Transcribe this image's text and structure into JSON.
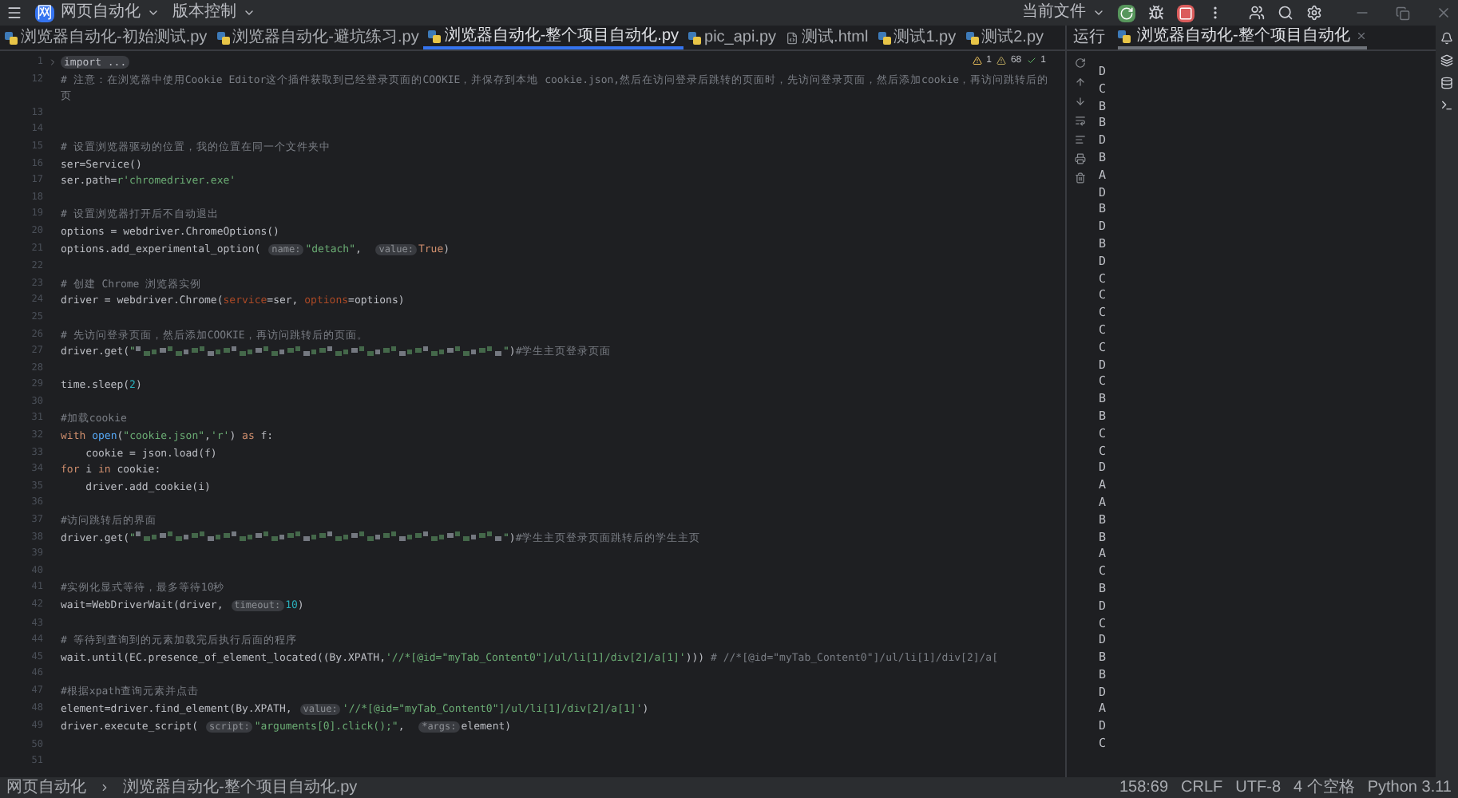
{
  "title_bar": {
    "project_badge": "网",
    "project": "网页自动化",
    "vcs": "版本控制",
    "run_config": "当前文件"
  },
  "editor_tabs": [
    {
      "label": "浏览器自动化-初始测试.py",
      "selected": false,
      "kind": "python"
    },
    {
      "label": "浏览器自动化-避坑练习.py",
      "selected": false,
      "kind": "python"
    },
    {
      "label": "浏览器自动化-整个项目自动化.py",
      "selected": true,
      "kind": "python"
    },
    {
      "label": "pic_api.py",
      "selected": false,
      "kind": "python"
    },
    {
      "label": "测试.html",
      "selected": false,
      "kind": "html"
    },
    {
      "label": "测试1.py",
      "selected": false,
      "kind": "python"
    },
    {
      "label": "测试2.py",
      "selected": false,
      "kind": "python"
    }
  ],
  "inspections": {
    "warnings": "1",
    "weak_warnings": "68",
    "ok": "1"
  },
  "code_lines": [
    {
      "number": "1",
      "segments": [
        {
          "kind": "folded",
          "text": "import ..."
        }
      ]
    },
    {
      "number": "12",
      "segments": [
        {
          "kind": "comment",
          "text": "# 注意：在浏览器中使用Cookie Editor这个插件获取到已经登录页面的COOKIE，并保存到本地 cookie.json,然后在访问登录后跳转的页面时，先访问登录页面，然后添加cookie，再访问跳转后的页"
        }
      ]
    },
    {
      "number": "13"
    },
    {
      "number": "14"
    },
    {
      "number": "15",
      "segments": [
        {
          "kind": "comment",
          "text": "# 设置浏览器驱动的位置，我的位置在同一个文件夹中"
        }
      ]
    },
    {
      "number": "16",
      "segments": [
        {
          "kind": "plain",
          "text": "ser=Service()"
        }
      ]
    },
    {
      "number": "17",
      "segments": [
        {
          "kind": "plain",
          "text": "ser.path="
        },
        {
          "kind": "string",
          "text": "r'chromedriver.exe'"
        }
      ]
    },
    {
      "number": "18"
    },
    {
      "number": "19",
      "segments": [
        {
          "kind": "comment",
          "text": "# 设置浏览器打开后不自动退出"
        }
      ]
    },
    {
      "number": "20",
      "segments": [
        {
          "kind": "plain",
          "text": "options = webdriver.ChromeOptions()"
        }
      ]
    },
    {
      "number": "21",
      "segments": [
        {
          "kind": "plain",
          "text": "options.add_experimental_option( "
        },
        {
          "kind": "hint",
          "text": "name:"
        },
        {
          "kind": "string",
          "text": "\"detach\""
        },
        {
          "kind": "plain",
          "text": ",  "
        },
        {
          "kind": "hint",
          "text": "value:"
        },
        {
          "kind": "keyword",
          "text": "True"
        },
        {
          "kind": "plain",
          "text": ")"
        }
      ]
    },
    {
      "number": "22"
    },
    {
      "number": "23",
      "segments": [
        {
          "kind": "comment",
          "text": "# 创建 Chrome 浏览器实例"
        }
      ]
    },
    {
      "number": "24",
      "segments": [
        {
          "kind": "plain",
          "text": "driver = webdriver.Chrome("
        },
        {
          "kind": "param",
          "text": "service"
        },
        {
          "kind": "plain",
          "text": "=ser, "
        },
        {
          "kind": "param",
          "text": "options"
        },
        {
          "kind": "plain",
          "text": "=options)"
        }
      ]
    },
    {
      "number": "25"
    },
    {
      "number": "26",
      "segments": [
        {
          "kind": "comment",
          "text": "# 先访问登录页面，然后添加COOKIE，再访问跳转后的页面。"
        }
      ]
    },
    {
      "number": "27",
      "segments": [
        {
          "kind": "plain",
          "text": "driver.get("
        },
        {
          "kind": "string",
          "text": "\""
        },
        {
          "kind": "redacted"
        },
        {
          "kind": "string",
          "text": "\""
        },
        {
          "kind": "plain",
          "text": ")"
        },
        {
          "kind": "comment",
          "text": "#学生主页登录页面"
        }
      ]
    },
    {
      "number": "28"
    },
    {
      "number": "29",
      "segments": [
        {
          "kind": "plain",
          "text": "time.sleep("
        },
        {
          "kind": "number",
          "text": "2"
        },
        {
          "kind": "plain",
          "text": ")"
        }
      ]
    },
    {
      "number": "30"
    },
    {
      "number": "31",
      "segments": [
        {
          "kind": "comment",
          "text": "#加载cookie"
        }
      ]
    },
    {
      "number": "32",
      "segments": [
        {
          "kind": "keyword",
          "text": "with "
        },
        {
          "kind": "builtin",
          "text": "open"
        },
        {
          "kind": "plain",
          "text": "("
        },
        {
          "kind": "string",
          "text": "\"cookie.json\""
        },
        {
          "kind": "plain",
          "text": ","
        },
        {
          "kind": "string",
          "text": "'r'"
        },
        {
          "kind": "plain",
          "text": ") "
        },
        {
          "kind": "keyword",
          "text": "as"
        },
        {
          "kind": "plain",
          "text": " f:"
        }
      ]
    },
    {
      "number": "33",
      "segments": [
        {
          "kind": "plain",
          "text": "    cookie = json.load(f)"
        }
      ]
    },
    {
      "number": "34",
      "segments": [
        {
          "kind": "keyword",
          "text": "for "
        },
        {
          "kind": "plain",
          "text": "i "
        },
        {
          "kind": "keyword",
          "text": "in "
        },
        {
          "kind": "plain",
          "text": "cookie:"
        }
      ]
    },
    {
      "number": "35",
      "segments": [
        {
          "kind": "plain",
          "text": "    driver.add_cookie(i)"
        }
      ]
    },
    {
      "number": "36"
    },
    {
      "number": "37",
      "segments": [
        {
          "kind": "comment",
          "text": "#访问跳转后的界面"
        }
      ]
    },
    {
      "number": "38",
      "segments": [
        {
          "kind": "plain",
          "text": "driver.get("
        },
        {
          "kind": "string",
          "text": "\""
        },
        {
          "kind": "redacted"
        },
        {
          "kind": "string",
          "text": "\""
        },
        {
          "kind": "plain",
          "text": ")"
        },
        {
          "kind": "comment",
          "text": "#学生主页登录页面跳转后的学生主页"
        }
      ]
    },
    {
      "number": "39"
    },
    {
      "number": "40"
    },
    {
      "number": "41",
      "segments": [
        {
          "kind": "comment",
          "text": "#实例化显式等待，最多等待10秒"
        }
      ]
    },
    {
      "number": "42",
      "segments": [
        {
          "kind": "plain",
          "text": "wait=WebDriverWait(driver, "
        },
        {
          "kind": "hint",
          "text": "timeout:"
        },
        {
          "kind": "number",
          "text": "10"
        },
        {
          "kind": "plain",
          "text": ")"
        }
      ]
    },
    {
      "number": "43"
    },
    {
      "number": "44",
      "segments": [
        {
          "kind": "comment",
          "text": "# 等待到查询到的元素加载完后执行后面的程序"
        }
      ]
    },
    {
      "number": "45",
      "segments": [
        {
          "kind": "plain",
          "text": "wait.until(EC.presence_of_element_located((By.XPATH,"
        },
        {
          "kind": "string",
          "text": "'//*[@id=\"myTab_Content0\"]/ul/li[1]/div[2]/a[1]'"
        },
        {
          "kind": "plain",
          "text": "))) "
        },
        {
          "kind": "comment",
          "text": "# //*[@id=\"myTab_Content0\"]/ul/li[1]/div[2]/a["
        }
      ]
    },
    {
      "number": "46"
    },
    {
      "number": "47",
      "segments": [
        {
          "kind": "comment",
          "text": "#根据xpath查询元素并点击"
        }
      ]
    },
    {
      "number": "48",
      "segments": [
        {
          "kind": "plain",
          "text": "element=driver.find_element(By.XPATH, "
        },
        {
          "kind": "hint",
          "text": "value:"
        },
        {
          "kind": "string",
          "text": "'//*[@id=\"myTab_Content0\"]/ul/li[1]/div[2]/a[1]'"
        },
        {
          "kind": "plain",
          "text": ")"
        }
      ]
    },
    {
      "number": "49",
      "segments": [
        {
          "kind": "plain",
          "text": "driver.execute_script( "
        },
        {
          "kind": "hint",
          "text": "script:"
        },
        {
          "kind": "string",
          "text": "\"arguments[0].click();\""
        },
        {
          "kind": "plain",
          "text": ",  "
        },
        {
          "kind": "hint",
          "text": "*args:"
        },
        {
          "kind": "plain",
          "text": "element)"
        }
      ]
    },
    {
      "number": "50"
    },
    {
      "number": "51"
    }
  ],
  "run_panel": {
    "title": "运行",
    "tabs": [
      {
        "label": "浏览器自动化-整个项目自动化",
        "selected": true
      }
    ],
    "output": [
      "D",
      "C",
      "B",
      "B",
      "D",
      "B",
      "A",
      "D",
      "B",
      "D",
      "B",
      "D",
      "C",
      "C",
      "C",
      "C",
      "C",
      "D",
      "C",
      "B",
      "B",
      "C",
      "C",
      "D",
      "A",
      "A",
      "B",
      "B",
      "A",
      "C",
      "B",
      "D",
      "C",
      "D",
      "B",
      "B",
      "D",
      "A",
      "D",
      "C"
    ]
  },
  "status_bar": {
    "breadcrumbs": [
      "网页自动化",
      "浏览器自动化-整个项目自动化.py"
    ],
    "position": "158:69",
    "line_ending": "CRLF",
    "encoding": "UTF-8",
    "indent": "4 个空格",
    "interpreter": "Python 3.11"
  }
}
